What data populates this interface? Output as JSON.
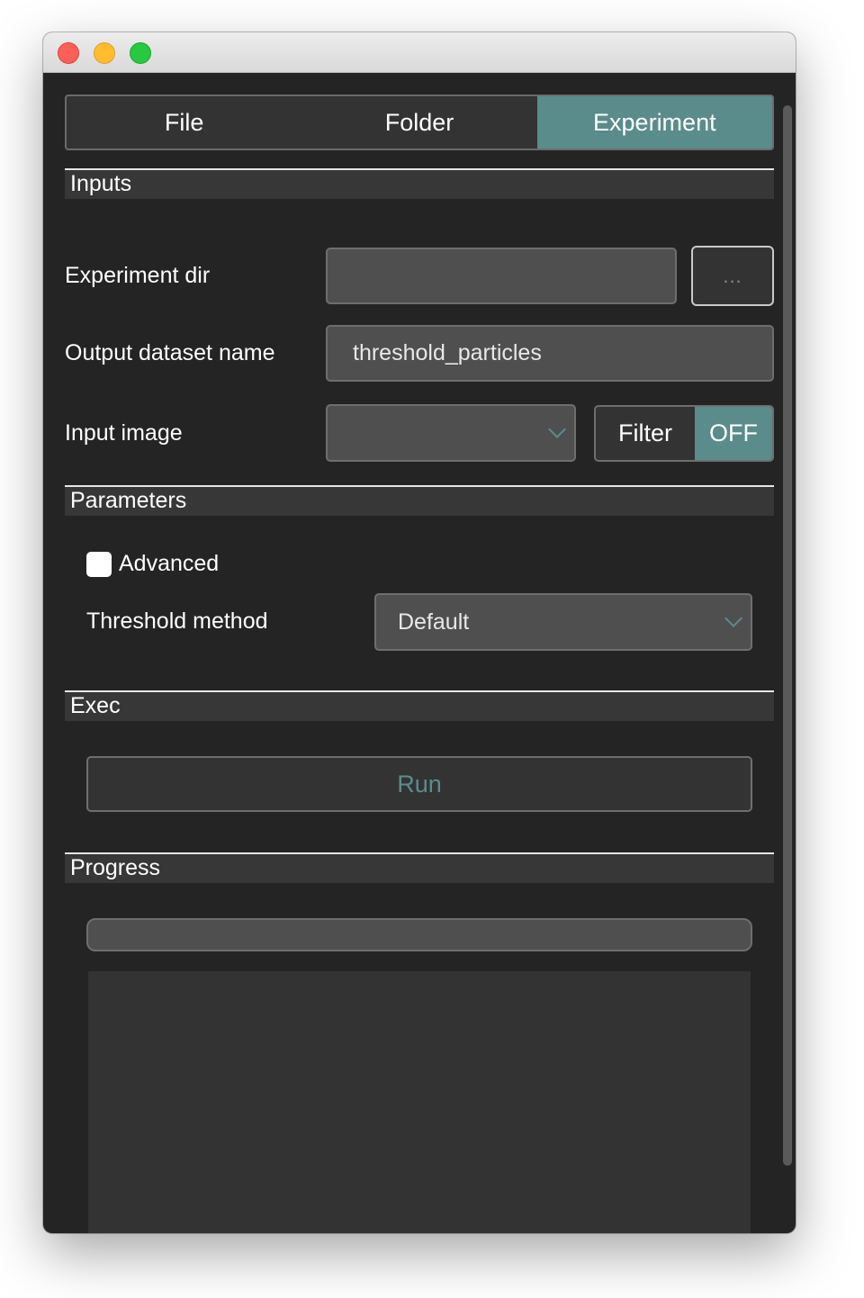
{
  "tabs": [
    {
      "label": "File",
      "active": false
    },
    {
      "label": "Folder",
      "active": false
    },
    {
      "label": "Experiment",
      "active": true
    }
  ],
  "sections": {
    "inputs": "Inputs",
    "parameters": "Parameters",
    "exec": "Exec",
    "progress": "Progress"
  },
  "inputs": {
    "experiment_dir": {
      "label": "Experiment dir",
      "value": "",
      "browse_label": "..."
    },
    "output_dataset_name": {
      "label": "Output dataset name",
      "value": "threshold_particles"
    },
    "input_image": {
      "label": "Input image",
      "selected": ""
    },
    "filter": {
      "label": "Filter",
      "state": "OFF"
    }
  },
  "parameters": {
    "advanced": {
      "label": "Advanced",
      "checked": false
    },
    "threshold_method": {
      "label": "Threshold method",
      "selected": "Default"
    }
  },
  "exec": {
    "run_label": "Run"
  },
  "progress": {
    "value": 0
  },
  "colors": {
    "accent": "#5b8c8c",
    "background": "#242424",
    "field": "#4f4f4f"
  },
  "icons": {
    "dropdown": "chevron-down-icon"
  }
}
